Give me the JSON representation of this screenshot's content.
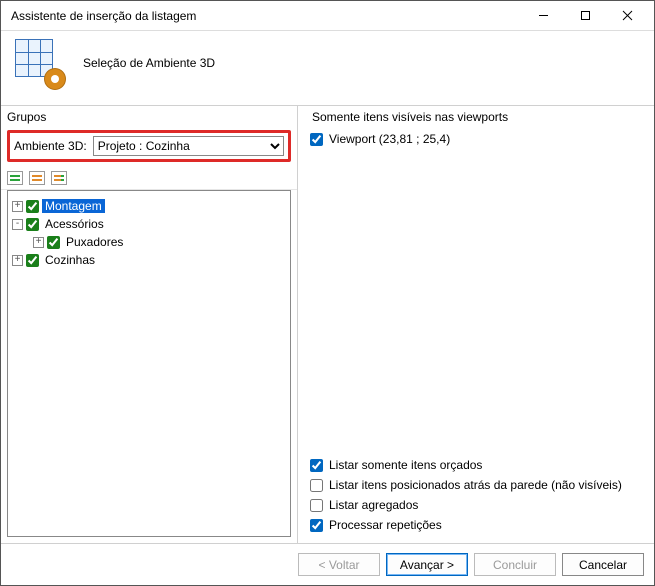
{
  "window": {
    "title": "Assistente de inserção da listagem"
  },
  "header": {
    "subtitle": "Seleção de Ambiente 3D"
  },
  "left": {
    "grupos_label": "Grupos",
    "ambient_label": "Ambiente 3D:",
    "ambient_value": "Projeto : Cozinha",
    "tree": {
      "montagem": "Montagem",
      "acessorios": "Acessórios",
      "puxadores": "Puxadores",
      "cozinhas": "Cozinhas"
    }
  },
  "right": {
    "section_label": "Somente itens visíveis nas viewports",
    "viewport_label": "Viewport (23,81 ; 25,4)",
    "options": {
      "orcados": "Listar somente itens orçados",
      "atras_parede": "Listar itens posicionados atrás da parede (não visíveis)",
      "agregados": "Listar agregados",
      "repeticoes": "Processar repetições"
    }
  },
  "footer": {
    "voltar": "< Voltar",
    "avancar": "Avançar >",
    "concluir": "Concluir",
    "cancelar": "Cancelar"
  }
}
